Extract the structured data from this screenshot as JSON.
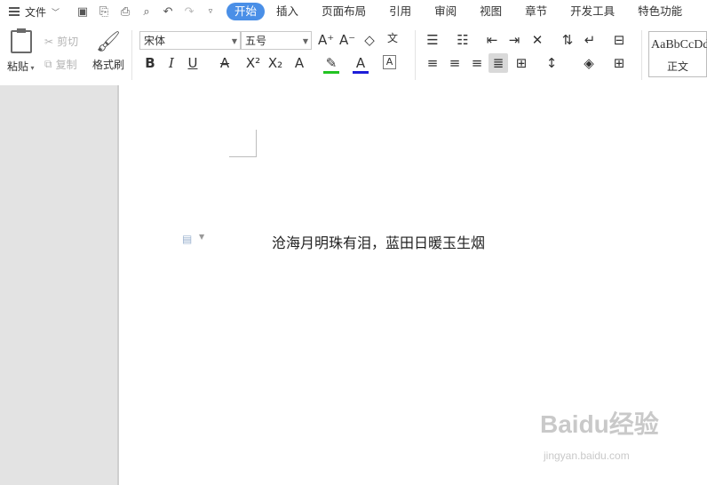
{
  "menubar": {
    "file_label": "文件",
    "tabs": [
      "开始",
      "插入",
      "页面布局",
      "引用",
      "审阅",
      "视图",
      "章节",
      "开发工具",
      "特色功能"
    ],
    "active_tab": "开始"
  },
  "clipboard": {
    "paste": "粘贴",
    "cut": "剪切",
    "copy": "复制",
    "format_painter": "格式刷"
  },
  "font": {
    "family": "宋体",
    "size": "五号"
  },
  "styles": {
    "preview": "AaBbCcDd",
    "name": "正文"
  },
  "document": {
    "text": "沧海月明珠有泪，蓝田日暖玉生烟"
  },
  "watermark": {
    "brand": "Baidu经验",
    "url": "jingyan.baidu.com"
  }
}
